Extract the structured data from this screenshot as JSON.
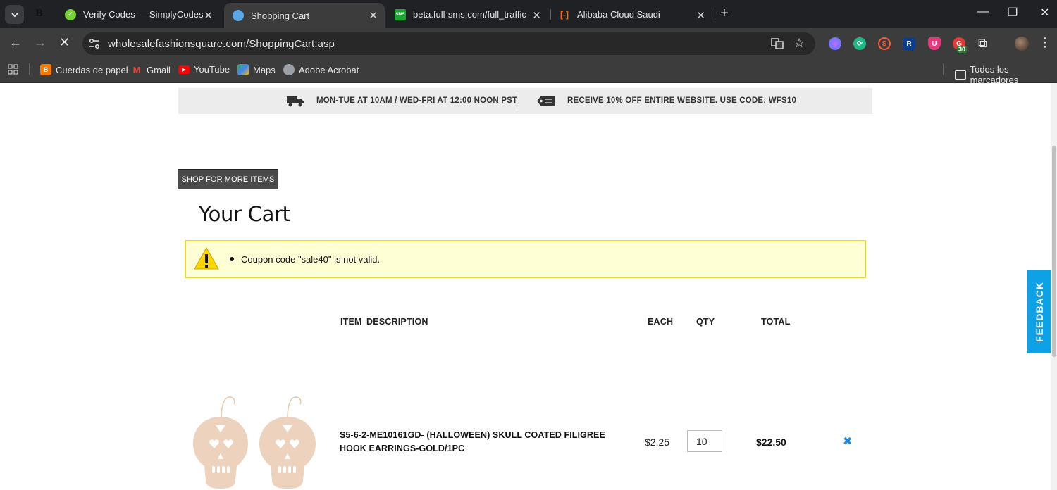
{
  "browser": {
    "tabs": [
      {
        "title": "Verify Codes — SimplyCodes",
        "favicon": "simplycodes-icon",
        "color": "#7ad03a"
      },
      {
        "title": "Shopping Cart",
        "favicon": "globe-icon",
        "color": "#5aa9e6"
      },
      {
        "title": "beta.full-sms.com/full_traffic",
        "favicon": "sms-icon",
        "favicon_text": "SMS",
        "color": "#1aa832"
      },
      {
        "title": "Alibaba Cloud Saudi",
        "favicon": "alibaba-icon",
        "color": "#ff6a00"
      }
    ],
    "url": "wholesalefashionsquare.com/ShoppingCart.asp",
    "bookmarks": [
      {
        "label": "Cuerdas de papel",
        "icon": "blogger-icon",
        "color": "#f57c00"
      },
      {
        "label": "Gmail",
        "icon": "gmail-icon",
        "color": "#ea4335"
      },
      {
        "label": "YouTube",
        "icon": "youtube-icon",
        "color": "#ff0000"
      },
      {
        "label": "Maps",
        "icon": "maps-icon",
        "color": "#34a853"
      },
      {
        "label": "Adobe Acrobat",
        "icon": "globe-icon",
        "color": "#9aa0a6"
      }
    ],
    "all_bookmarks": "Todos los marcadores",
    "extension_badge": "30"
  },
  "promo": {
    "hours": "MON-TUE AT 10AM / WED-FRI AT 12:00 NOON PST",
    "discount": "RECEIVE 10% OFF ENTIRE WEBSITE. USE CODE: WFS10"
  },
  "cart": {
    "shop_more": "SHOP FOR MORE ITEMS",
    "title": "Your Cart",
    "alert": "Coupon code \"sale40\" is not valid.",
    "headers": {
      "item": "ITEM",
      "description": "DESCRIPTION",
      "each": "EACH",
      "qty": "QTY",
      "total": "TOTAL"
    },
    "items": [
      {
        "description": "S5-6-2-ME10161GD- (HALLOWEEN) SKULL COATED FILIGREE HOOK EARRINGS-GOLD/1PC",
        "each": "$2.25",
        "qty": "10",
        "total": "$22.50"
      }
    ],
    "remove_symbol": "✖"
  },
  "feedback": "FEEDBACK"
}
